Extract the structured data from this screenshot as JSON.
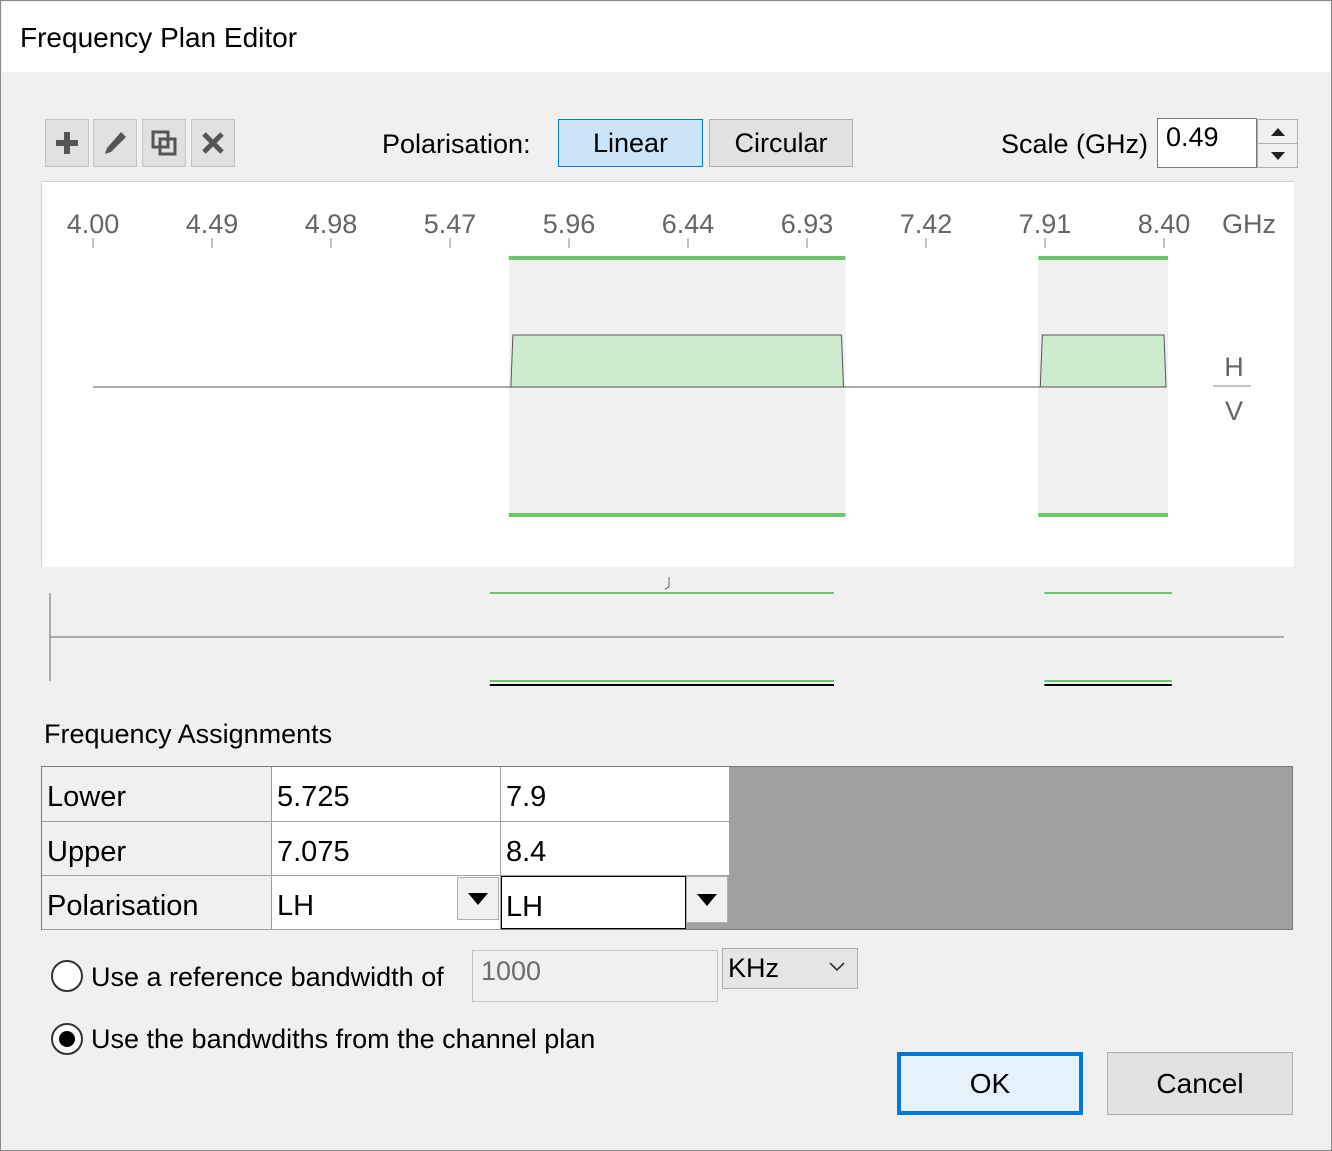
{
  "window": {
    "title": "Frequency Plan Editor"
  },
  "toolbar": {
    "buttons": [
      {
        "name": "add-icon"
      },
      {
        "name": "edit-icon"
      },
      {
        "name": "duplicate-icon"
      },
      {
        "name": "delete-icon"
      }
    ],
    "polarisation_label": "Polarisation:",
    "polarisation_options": [
      "Linear",
      "Circular"
    ],
    "polarisation_selected": "Linear",
    "scale_label": "Scale (GHz)",
    "scale_value": "0.49"
  },
  "chart_data": {
    "type": "spectrum-plan",
    "unit": "GHz",
    "ticks": [
      "4.00",
      "4.49",
      "4.98",
      "5.47",
      "5.96",
      "6.44",
      "6.93",
      "7.42",
      "7.91",
      "8.40"
    ],
    "xlim": [
      4.0,
      8.4
    ],
    "upper_label": "H",
    "lower_label": "V",
    "bands": [
      {
        "lower": 5.725,
        "upper": 7.075
      },
      {
        "lower": 7.9,
        "upper": 8.4
      }
    ]
  },
  "assignments": {
    "title": "Frequency Assignments",
    "row_labels": [
      "Lower",
      "Upper",
      "Polarisation"
    ],
    "columns": [
      {
        "lower": "5.725",
        "upper": "7.075",
        "polarisation": "LH"
      },
      {
        "lower": "7.9",
        "upper": "8.4",
        "polarisation": "LH"
      }
    ]
  },
  "bandwidth": {
    "option_reference": "Use a reference bandwidth of",
    "reference_value": "1000",
    "reference_unit": "KHz",
    "option_channel_plan": "Use the bandwdiths from the channel plan",
    "selected": "channel_plan"
  },
  "buttons": {
    "ok": "OK",
    "cancel": "Cancel"
  },
  "colors": {
    "band_line": "#6cc46c",
    "band_fill": "#cdebcd",
    "band_bg": "#f0f0f0",
    "accent": "#0078d7"
  }
}
